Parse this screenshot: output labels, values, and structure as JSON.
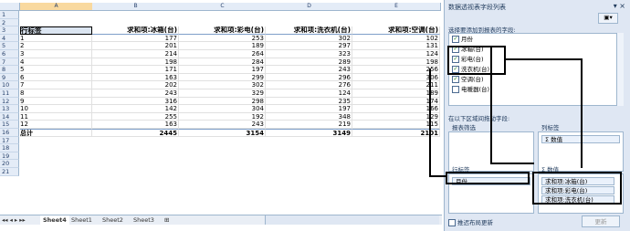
{
  "sheet": {
    "columns": [
      "A",
      "B",
      "C",
      "D",
      "E"
    ],
    "rows": [
      "1",
      "2",
      "3",
      "4",
      "5",
      "6",
      "7",
      "8",
      "9",
      "10",
      "11",
      "12",
      "13",
      "14",
      "15",
      "16",
      "17",
      "18",
      "19",
      "20",
      "21"
    ],
    "headers": [
      "行标签",
      "求和项:冰箱(台)",
      "求和项:彩电(台)",
      "求和项:洗衣机(台)",
      "求和项:空调(台)"
    ],
    "data": [
      [
        "1",
        "177",
        "253",
        "302",
        "102"
      ],
      [
        "2",
        "201",
        "189",
        "297",
        "131"
      ],
      [
        "3",
        "214",
        "264",
        "323",
        "124"
      ],
      [
        "4",
        "198",
        "284",
        "289",
        "198"
      ],
      [
        "5",
        "171",
        "197",
        "243",
        "256"
      ],
      [
        "6",
        "163",
        "299",
        "296",
        "306"
      ],
      [
        "7",
        "202",
        "302",
        "276",
        "211"
      ],
      [
        "8",
        "243",
        "329",
        "124",
        "189"
      ],
      [
        "9",
        "316",
        "298",
        "235",
        "174"
      ],
      [
        "10",
        "142",
        "304",
        "197",
        "166"
      ],
      [
        "11",
        "255",
        "192",
        "348",
        "129"
      ],
      [
        "12",
        "163",
        "243",
        "219",
        "115"
      ]
    ],
    "total": [
      "总计",
      "2445",
      "3154",
      "3149",
      "2101"
    ],
    "tabs": [
      "Sheet4",
      "Sheet1",
      "Sheet2",
      "Sheet3"
    ]
  },
  "pane": {
    "title": "数据透视表字段列表",
    "choose_label": "选择要添加到报表的字段:",
    "fields": [
      {
        "label": "月份",
        "checked": true
      },
      {
        "label": "冰箱(台)",
        "checked": true
      },
      {
        "label": "彩电(台)",
        "checked": true
      },
      {
        "label": "洗衣机(台)",
        "checked": true
      },
      {
        "label": "空调(台)",
        "checked": true
      },
      {
        "label": "电暖器(台)",
        "checked": false
      }
    ],
    "drag_label": "在以下区域间拖动字段:",
    "report_filter": "报表筛选",
    "column_labels": "列标签",
    "column_value": "Σ 数值",
    "row_labels": "行标签",
    "row_value": "月份",
    "values_label": "Σ 数值",
    "values": [
      "求和项:冰箱(台)",
      "求和项:彩电(台)",
      "求和项:洗衣机(台)"
    ],
    "defer_label": "推迟布局更新",
    "update_label": "更新"
  }
}
